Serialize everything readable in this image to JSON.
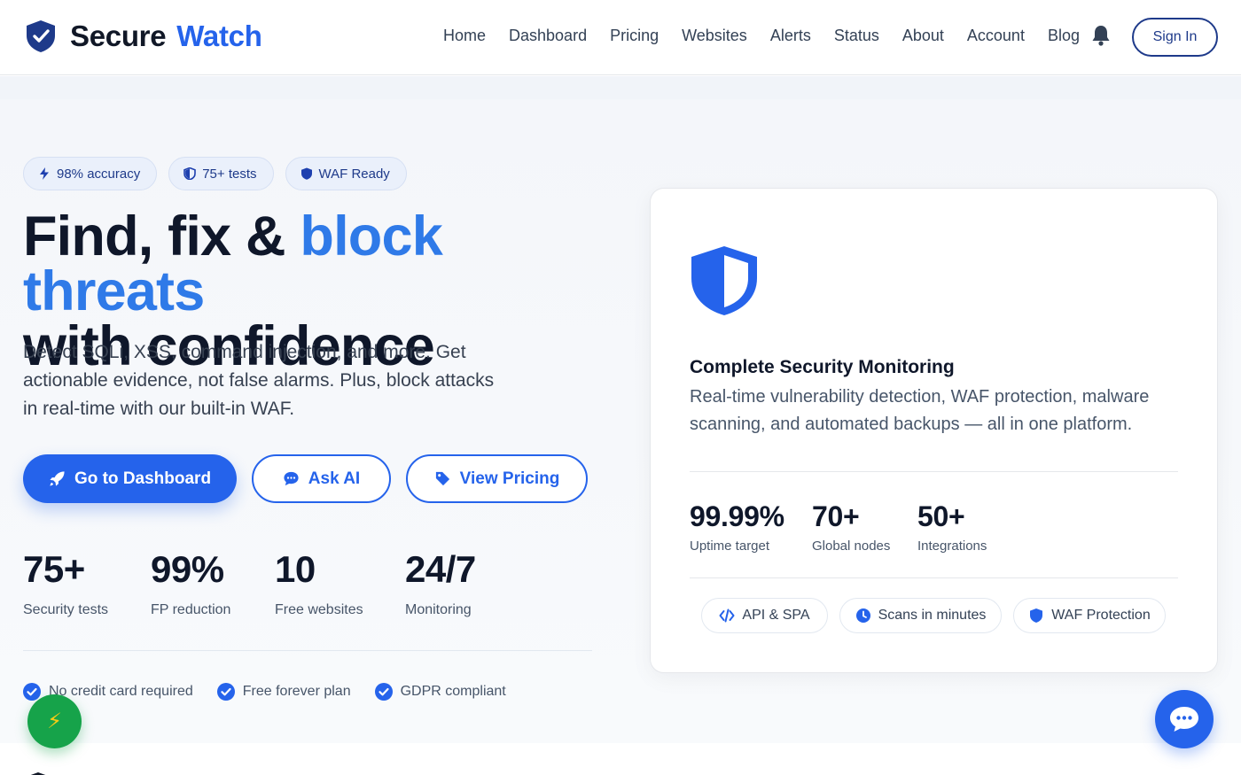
{
  "brand": {
    "name_part1": "Secure",
    "name_part2": "Watch"
  },
  "nav": {
    "links": [
      "Home",
      "Dashboard",
      "Pricing",
      "Websites",
      "Alerts",
      "Status",
      "About",
      "Account",
      "Blog"
    ],
    "signin_label": "Sign In"
  },
  "hero": {
    "badges": [
      "98% accuracy",
      "75+ tests",
      "WAF Ready"
    ],
    "headline_line1_plain": "Find, fix & ",
    "headline_line1_accent": "block threats",
    "headline_line2": "with confidence",
    "subtext": "Detect SQLi, XSS, command injection, and more. Get actionable evidence, not false alarms. Plus, block attacks in real-time with our built-in WAF.",
    "cta_primary": "Go to Dashboard",
    "cta_ask": "Ask AI",
    "cta_pricing": "View Pricing",
    "stats": [
      {
        "value": "75+",
        "label": "Security tests"
      },
      {
        "value": "99%",
        "label": "FP reduction"
      },
      {
        "value": "10",
        "label": "Free websites"
      },
      {
        "value": "24/7",
        "label": "Monitoring"
      }
    ],
    "checks": [
      "No credit card required",
      "Free forever plan",
      "GDPR compliant"
    ]
  },
  "card": {
    "title": "Complete Security Monitoring",
    "description": "Real-time vulnerability detection, WAF protection, malware scanning, and automated backups — all in one platform.",
    "stats": [
      {
        "value": "99.99%",
        "label": "Uptime target"
      },
      {
        "value": "70+",
        "label": "Global nodes"
      },
      {
        "value": "50+",
        "label": "Integrations"
      }
    ],
    "chips": [
      "API & SPA",
      "Scans in minutes",
      "WAF Protection"
    ]
  },
  "fab": {
    "bolt_glyph": "⚡"
  },
  "colors": {
    "accent": "#2563eb",
    "heading": "#0f172a",
    "fab_green": "#16a34a"
  }
}
